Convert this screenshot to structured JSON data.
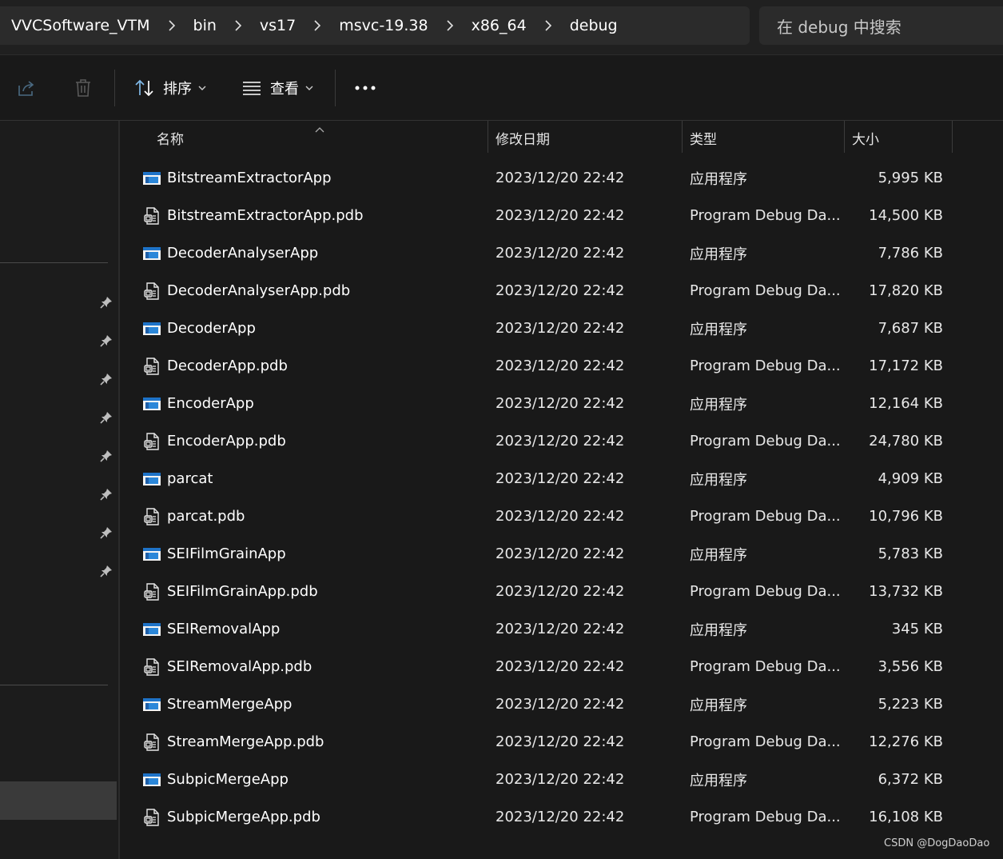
{
  "breadcrumb": [
    "VVCSoftware_VTM",
    "bin",
    "vs17",
    "msvc-19.38",
    "x86_64",
    "debug"
  ],
  "search": {
    "placeholder": "在 debug 中搜索"
  },
  "toolbar": {
    "sort_label": "排序",
    "view_label": "查看"
  },
  "columns": {
    "name": "名称",
    "date": "修改日期",
    "type": "类型",
    "size": "大小"
  },
  "files": [
    {
      "name": "BitstreamExtractorApp",
      "date": "2023/12/20 22:42",
      "type": "应用程序",
      "size": "5,995 KB",
      "icon": "application-icon"
    },
    {
      "name": "BitstreamExtractorApp.pdb",
      "date": "2023/12/20 22:42",
      "type": "Program Debug Da...",
      "size": "14,500 KB",
      "icon": "pdb-file-icon"
    },
    {
      "name": "DecoderAnalyserApp",
      "date": "2023/12/20 22:42",
      "type": "应用程序",
      "size": "7,786 KB",
      "icon": "application-icon"
    },
    {
      "name": "DecoderAnalyserApp.pdb",
      "date": "2023/12/20 22:42",
      "type": "Program Debug Da...",
      "size": "17,820 KB",
      "icon": "pdb-file-icon"
    },
    {
      "name": "DecoderApp",
      "date": "2023/12/20 22:42",
      "type": "应用程序",
      "size": "7,687 KB",
      "icon": "application-icon"
    },
    {
      "name": "DecoderApp.pdb",
      "date": "2023/12/20 22:42",
      "type": "Program Debug Da...",
      "size": "17,172 KB",
      "icon": "pdb-file-icon"
    },
    {
      "name": "EncoderApp",
      "date": "2023/12/20 22:42",
      "type": "应用程序",
      "size": "12,164 KB",
      "icon": "application-icon"
    },
    {
      "name": "EncoderApp.pdb",
      "date": "2023/12/20 22:42",
      "type": "Program Debug Da...",
      "size": "24,780 KB",
      "icon": "pdb-file-icon"
    },
    {
      "name": "parcat",
      "date": "2023/12/20 22:42",
      "type": "应用程序",
      "size": "4,909 KB",
      "icon": "application-icon"
    },
    {
      "name": "parcat.pdb",
      "date": "2023/12/20 22:42",
      "type": "Program Debug Da...",
      "size": "10,796 KB",
      "icon": "pdb-file-icon"
    },
    {
      "name": "SEIFilmGrainApp",
      "date": "2023/12/20 22:42",
      "type": "应用程序",
      "size": "5,783 KB",
      "icon": "application-icon"
    },
    {
      "name": "SEIFilmGrainApp.pdb",
      "date": "2023/12/20 22:42",
      "type": "Program Debug Da...",
      "size": "13,732 KB",
      "icon": "pdb-file-icon"
    },
    {
      "name": "SEIRemovalApp",
      "date": "2023/12/20 22:42",
      "type": "应用程序",
      "size": "345 KB",
      "icon": "application-icon"
    },
    {
      "name": "SEIRemovalApp.pdb",
      "date": "2023/12/20 22:42",
      "type": "Program Debug Da...",
      "size": "3,556 KB",
      "icon": "pdb-file-icon"
    },
    {
      "name": "StreamMergeApp",
      "date": "2023/12/20 22:42",
      "type": "应用程序",
      "size": "5,223 KB",
      "icon": "application-icon"
    },
    {
      "name": "StreamMergeApp.pdb",
      "date": "2023/12/20 22:42",
      "type": "Program Debug Da...",
      "size": "12,276 KB",
      "icon": "pdb-file-icon"
    },
    {
      "name": "SubpicMergeApp",
      "date": "2023/12/20 22:42",
      "type": "应用程序",
      "size": "6,372 KB",
      "icon": "application-icon"
    },
    {
      "name": "SubpicMergeApp.pdb",
      "date": "2023/12/20 22:42",
      "type": "Program Debug Da...",
      "size": "16,108 KB",
      "icon": "pdb-file-icon"
    }
  ],
  "watermark": "CSDN @DogDaoDao",
  "colors": {
    "background": "#191919",
    "panel": "#2b2b2b",
    "accent": "#4aa3e8"
  }
}
